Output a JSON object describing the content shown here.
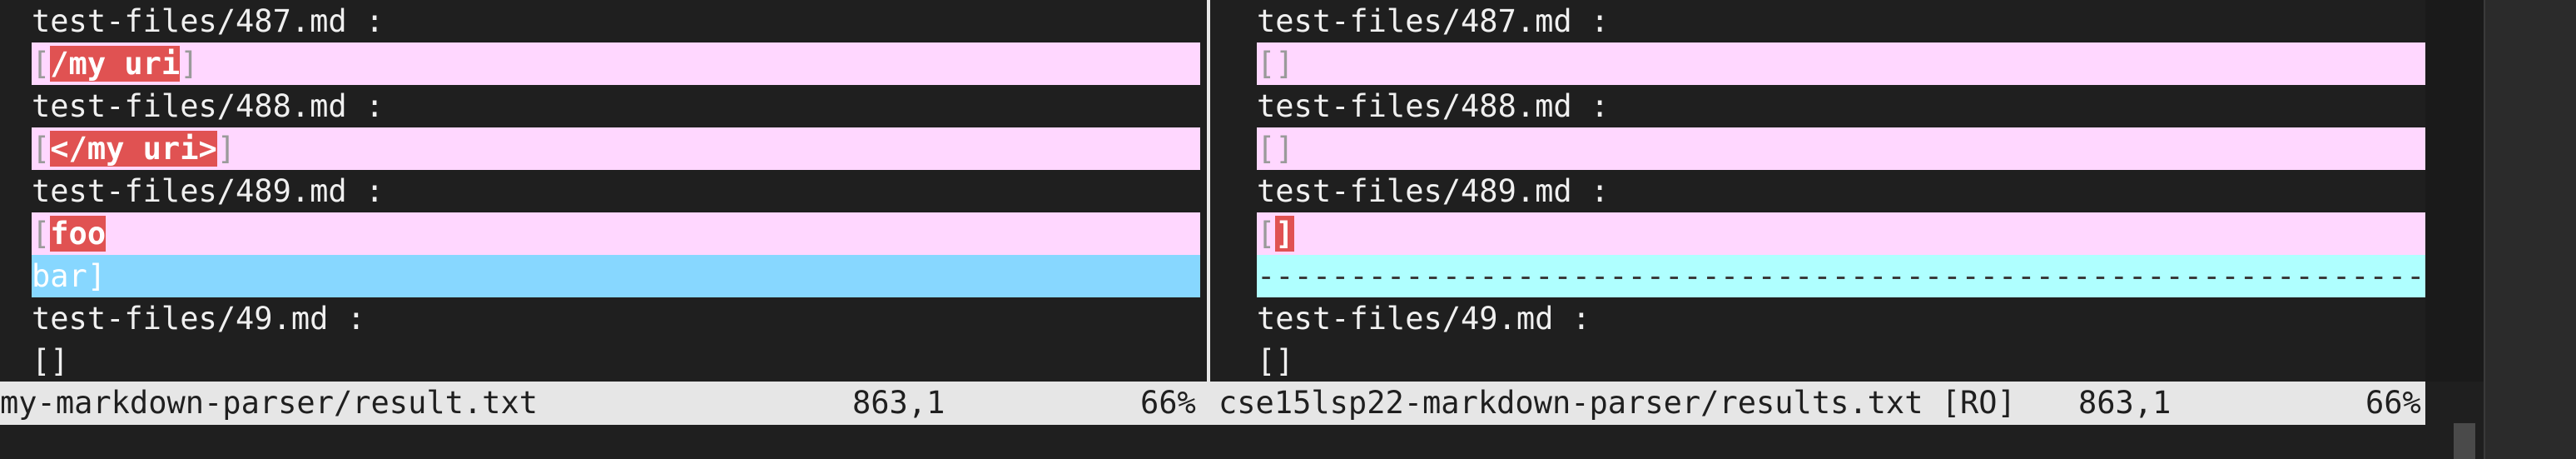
{
  "left_pane": {
    "lines": [
      {
        "kind": "normal",
        "text": "test-files/487.md :"
      },
      {
        "kind": "changed",
        "pre": "[",
        "hl": "/my uri",
        "post": "]"
      },
      {
        "kind": "normal",
        "text": "test-files/488.md :"
      },
      {
        "kind": "changed",
        "pre": "[",
        "hl": "</my uri>",
        "post": "]"
      },
      {
        "kind": "normal",
        "text": "test-files/489.md :"
      },
      {
        "kind": "changed",
        "pre": "[",
        "hl": "foo",
        "post": ""
      },
      {
        "kind": "added",
        "text": "bar]"
      },
      {
        "kind": "normal",
        "text": "test-files/49.md :"
      },
      {
        "kind": "normal",
        "text": "[]"
      }
    ]
  },
  "right_pane": {
    "lines": [
      {
        "kind": "normal",
        "text": "test-files/487.md :"
      },
      {
        "kind": "changed",
        "pre": "[]",
        "hl": "",
        "post": ""
      },
      {
        "kind": "normal",
        "text": "test-files/488.md :"
      },
      {
        "kind": "changed",
        "pre": "[]",
        "hl": "",
        "post": ""
      },
      {
        "kind": "normal",
        "text": "test-files/489.md :"
      },
      {
        "kind": "changed",
        "pre": "[",
        "hl": "]",
        "post": ""
      },
      {
        "kind": "filler",
        "text": "--------------------------------------------------------------------------------"
      },
      {
        "kind": "normal",
        "text": "test-files/49.md :"
      },
      {
        "kind": "normal",
        "text": "[]"
      }
    ]
  },
  "status_left": {
    "file": "my-markdown-parser/result.txt",
    "position": "863,1",
    "percent": "66%"
  },
  "status_right": {
    "file": "cse15lsp22-markdown-parser/results.txt [RO]",
    "position": "863,1",
    "percent": "66%"
  },
  "colors": {
    "changed_bg": "#ffd7ff",
    "added_bg": "#87d7ff",
    "filler_bg": "#afffff",
    "highlight_bg": "#e05252",
    "editor_bg": "#1f1f1f",
    "status_bg": "#e6e6e6"
  }
}
